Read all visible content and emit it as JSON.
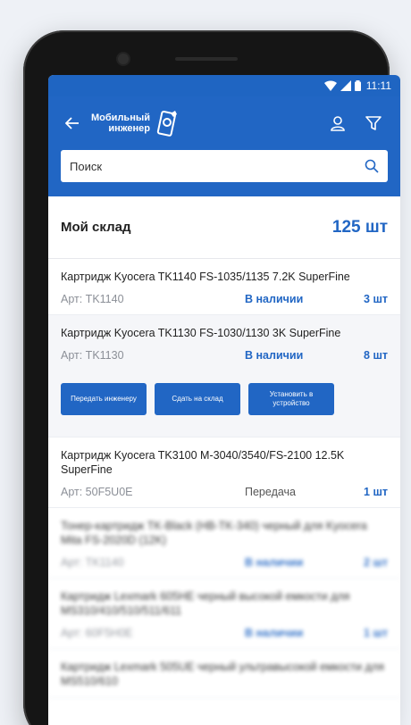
{
  "status_bar": {
    "time": "11:11"
  },
  "app": {
    "logo_line1": "Мобильный",
    "logo_line2": "инженер"
  },
  "search": {
    "placeholder": "Поиск"
  },
  "summary": {
    "label": "Мой склад",
    "count": "125 шт"
  },
  "items": [
    {
      "title": "Картридж Kyocera TK1140 FS-1035/1135 7.2K SuperFine",
      "art": "Арт: TK1140",
      "status": "В наличии",
      "qty": "3 шт"
    },
    {
      "title": "Картридж Kyocera TK1130  FS-1030/1130 3K SuperFine",
      "art": "Арт: TK1130",
      "status": "В наличии",
      "qty": "8 шт"
    },
    {
      "title": "Картридж Kyocera TK3100 M-3040/3540/FS-2100 12.5K SuperFine",
      "art": "Арт: 50F5U0E",
      "status": "Передача",
      "qty": "1 шт"
    },
    {
      "title": "Тонер-картридж TK-Black (HB-TK-340) черный для Kyocera Mita FS-2020D (12K)",
      "art": "Арт: TK1140",
      "status": "В наличии",
      "qty": "2 шт"
    },
    {
      "title": "Картридж Lexmark 605HE черный высокой емкости для MS310/410/510/511/611",
      "art": "Арт: 60F5H0E",
      "status": "В наличии",
      "qty": "1 шт"
    },
    {
      "title": "Картридж Lexmark 505UE черный ультравысокой емкости для MS510/610",
      "art": "",
      "status": "",
      "qty": ""
    }
  ],
  "actions": [
    {
      "label": "Передать инженеру"
    },
    {
      "label": "Сдать на склад"
    },
    {
      "label": "Установить в устройство"
    }
  ]
}
